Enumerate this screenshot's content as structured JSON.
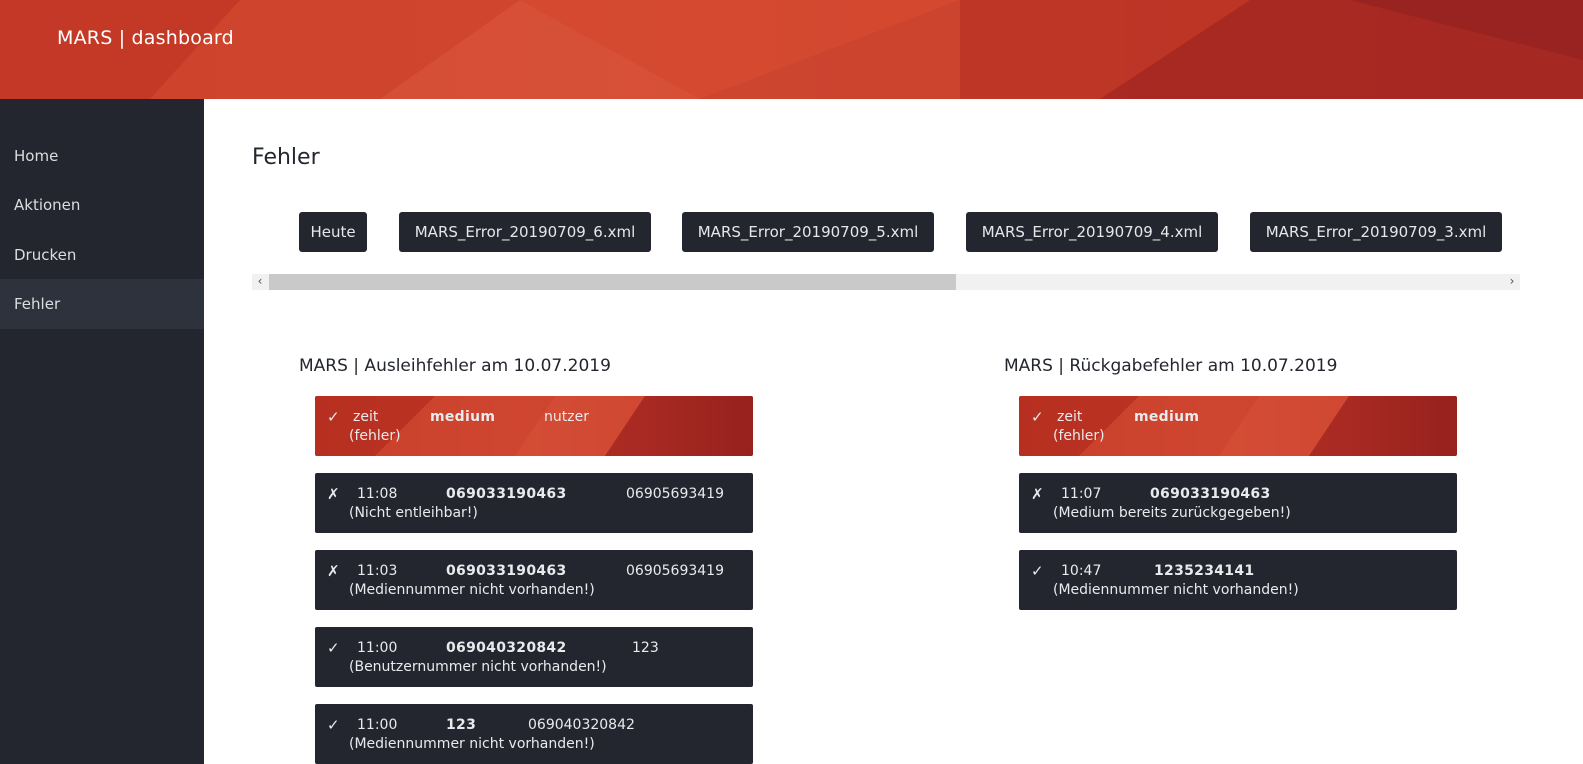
{
  "app": {
    "title": "MARS | dashboard"
  },
  "colors": {
    "accent": "#d24a30",
    "dark": "#23262f",
    "sidebar_active": "#2e323c"
  },
  "sidebar": {
    "items": [
      {
        "label": "Home"
      },
      {
        "label": "Aktionen"
      },
      {
        "label": "Drucken"
      },
      {
        "label": "Fehler",
        "active": true
      }
    ]
  },
  "page": {
    "title": "Fehler"
  },
  "files": [
    {
      "label": "Heute"
    },
    {
      "label": "MARS_Error_20190709_6.xml"
    },
    {
      "label": "MARS_Error_20190709_5.xml"
    },
    {
      "label": "MARS_Error_20190709_4.xml"
    },
    {
      "label": "MARS_Error_20190709_3.xml"
    }
  ],
  "scroll": {
    "left_icon": "chevron-left-icon",
    "right_icon": "chevron-right-icon"
  },
  "ausleihe": {
    "title": "MARS | Ausleihfehler am 10.07.2019",
    "header": {
      "mark": "✓",
      "zeit": "zeit",
      "medium": "medium",
      "nutzer": "nutzer",
      "fehler": "(fehler)"
    },
    "rows": [
      {
        "mark": "✗",
        "zeit": "11:08",
        "medium": "069033190463",
        "nutzer": "06905693419",
        "fehler": "(Nicht entleihbar!)"
      },
      {
        "mark": "✗",
        "zeit": "11:03",
        "medium": "069033190463",
        "nutzer": "06905693419",
        "fehler": "(Mediennummer nicht vorhanden!)"
      },
      {
        "mark": "✓",
        "zeit": "11:00",
        "medium": "069040320842",
        "nutzer": "123",
        "fehler": "(Benutzernummer nicht vorhanden!)"
      },
      {
        "mark": "✓",
        "zeit": "11:00",
        "medium": "123",
        "nutzer": "069040320842",
        "fehler": "(Mediennummer nicht vorhanden!)"
      }
    ]
  },
  "rueckgabe": {
    "title": "MARS | Rückgabefehler am 10.07.2019",
    "header": {
      "mark": "✓",
      "zeit": "zeit",
      "medium": "medium",
      "fehler": "(fehler)"
    },
    "rows": [
      {
        "mark": "✗",
        "zeit": "11:07",
        "medium": "069033190463",
        "fehler": "(Medium bereits zurückgegeben!)"
      },
      {
        "mark": "✓",
        "zeit": "10:47",
        "medium": "1235234141",
        "fehler": "(Mediennummer nicht vorhanden!)"
      }
    ]
  }
}
